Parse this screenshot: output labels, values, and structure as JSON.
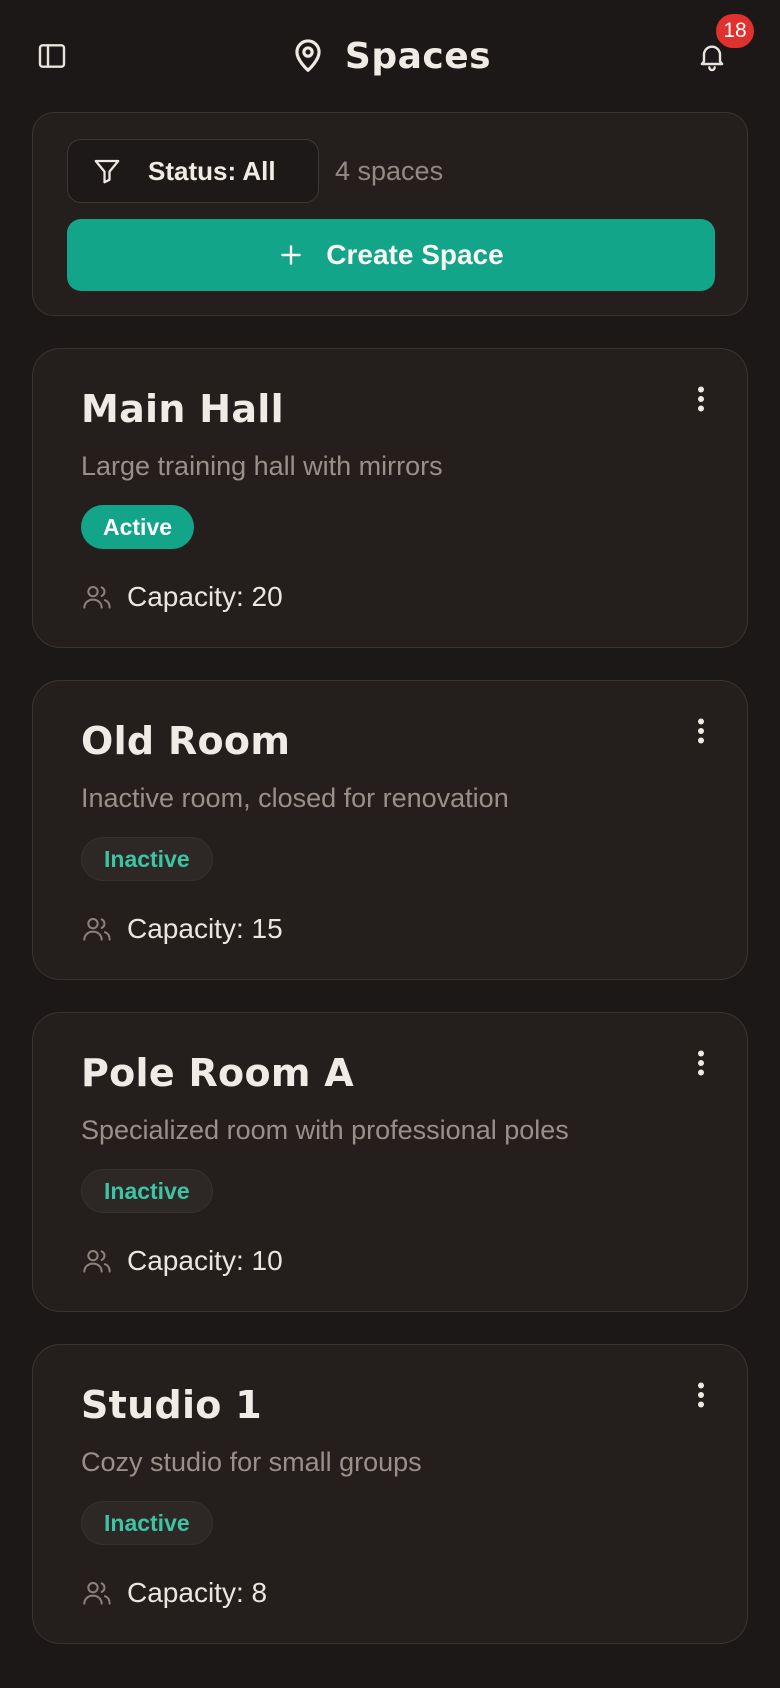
{
  "header": {
    "title": "Spaces",
    "notification_count": "18",
    "icons": {
      "sidebar": "sidebar-toggle-icon",
      "title": "map-pin-icon",
      "notifications": "bell-icon"
    }
  },
  "filters": {
    "status_label": "Status: All",
    "count_label": "4 spaces",
    "create_label": "Create Space",
    "icons": {
      "filter": "filter-icon",
      "create": "plus-icon"
    }
  },
  "colors": {
    "background": "#1c1817",
    "card": "#241f1d",
    "accent": "#12a58a",
    "inactive_text": "#3dc4a4",
    "badge": "#e0312f"
  },
  "spaces": [
    {
      "name": "Main Hall",
      "description": "Large training hall with mirrors",
      "status": "Active",
      "capacity": "Capacity: 20"
    },
    {
      "name": "Old Room",
      "description": "Inactive room, closed for renovation",
      "status": "Inactive",
      "capacity": "Capacity: 15"
    },
    {
      "name": "Pole Room A",
      "description": "Specialized room with professional poles",
      "status": "Inactive",
      "capacity": "Capacity: 10"
    },
    {
      "name": "Studio 1",
      "description": "Cozy studio for small groups",
      "status": "Inactive",
      "capacity": "Capacity: 8"
    }
  ]
}
